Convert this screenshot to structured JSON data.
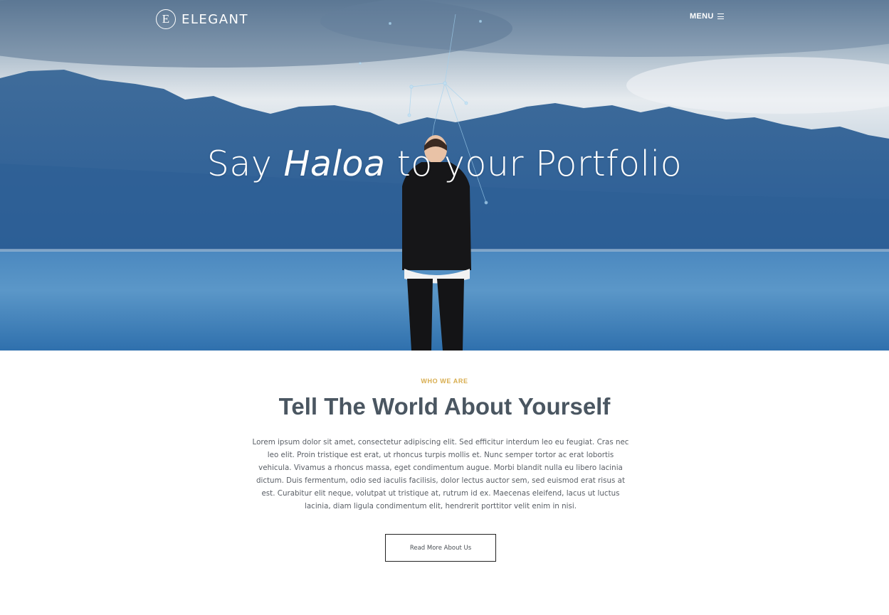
{
  "header": {
    "logo_letter": "E",
    "logo_text": "ELEGANT",
    "menu_label": "MENU"
  },
  "hero": {
    "title_before": "Say ",
    "title_emphasis": "Haloa",
    "title_after": " to your Portfolio"
  },
  "about": {
    "eyebrow": "WHO WE ARE",
    "title": "Tell The World About Yourself",
    "body": "Lorem ipsum dolor sit amet, consectetur adipiscing elit. Sed efficitur interdum leo eu feugiat. Cras nec leo elit. Proin tristique est erat, ut rhoncus turpis mollis et. Nunc semper tortor ac erat lobortis vehicula. Vivamus a rhoncus massa, eget condimentum augue. Morbi blandit nulla eu libero lacinia dictum. Duis fermentum, odio sed iaculis facilisis, dolor lectus auctor sem, sed euismod erat risus at est. Curabitur elit neque, volutpat ut tristique at, rutrum id ex. Maecenas eleifend, lacus ut luctus lacinia, diam ligula condimentum elit, hendrerit porttitor velit enim in nisi.",
    "button_label": "Read More About Us"
  },
  "colors": {
    "accent": "#d8ad4f",
    "heading": "#4a5661"
  }
}
